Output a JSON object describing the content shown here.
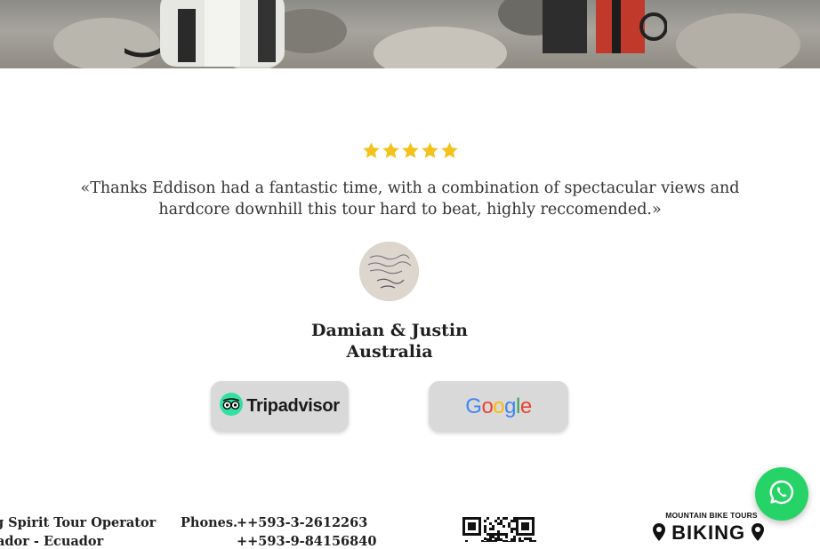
{
  "testimonial": {
    "rating": 5,
    "star_color": "#f3c21b",
    "quote": "«Thanks Eddison had a fantastic time, with a combination of spectacular views and hardcore downhill this tour hard to beat, highly reccomended.»",
    "author_name": "Damian & Justin",
    "author_country": "Australia"
  },
  "review_links": {
    "tripadvisor": {
      "label": "Tripadvisor",
      "icon": "tripadvisor-owl-icon",
      "color": "#34e0a1"
    },
    "google": {
      "letters": [
        "G",
        "o",
        "o",
        "g",
        "l",
        "e"
      ],
      "colors": [
        "#4285f4",
        "#ea4335",
        "#fbbc05",
        "#4285f4",
        "#34a853",
        "#ea4335"
      ]
    }
  },
  "whatsapp": {
    "icon": "whatsapp-icon",
    "color": "#25d366"
  },
  "footer": {
    "company_line1": "g Spirit Tour Operator",
    "company_line2": "ador - Ecuador",
    "phones_label": "Phones.",
    "phone1": "++593-3-2612263",
    "phone2": "++593-9-84156840",
    "brand_tagline": "MOUNTAIN BIKE TOURS",
    "brand_name": "BIKING"
  }
}
